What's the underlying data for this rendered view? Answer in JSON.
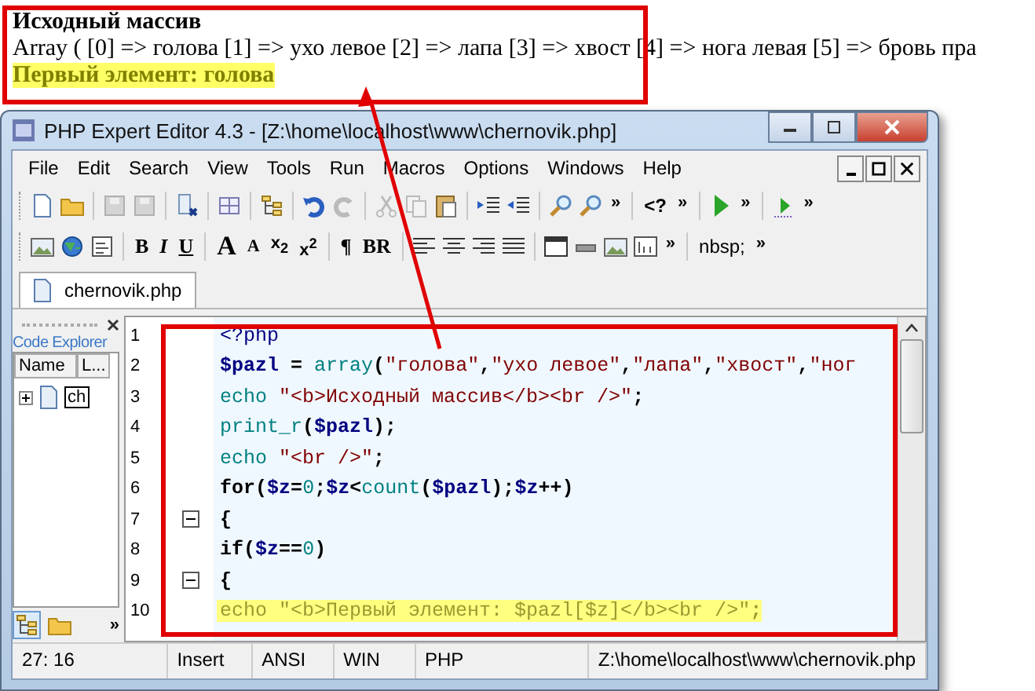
{
  "output": {
    "heading": "Исходный массив",
    "array_line": "Array ( [0] => голова [1] => ухо левое [2] => лапа [3] => хвост [4] => нога левая [5] => бровь пра",
    "first_element": "Первый элемент: голова"
  },
  "window": {
    "title": "PHP Expert Editor 4.3 - [Z:\\home\\localhost\\www\\chernovik.php]"
  },
  "menu": [
    "File",
    "Edit",
    "Search",
    "View",
    "Tools",
    "Run",
    "Macros",
    "Options",
    "Windows",
    "Help"
  ],
  "toolbar_1": [
    "»",
    "<?",
    "»",
    "»",
    "»"
  ],
  "toolbar_2": [
    "B",
    "I",
    "U",
    "A",
    "A",
    "x$_{2}$",
    "x$^{2}$",
    "¶",
    "BR",
    "»",
    "nbsp;",
    "»"
  ],
  "tabs": [
    {
      "label": "chernovik.php",
      "selected": true
    }
  ],
  "code_explorer": {
    "title": "Code Explorer",
    "columns": [
      "Name",
      "L..."
    ],
    "items": [
      {
        "label": "ch",
        "expanded": false
      }
    ],
    "more": "»"
  },
  "editor": {
    "lines": [
      {
        "number": "1",
        "fold": false,
        "highlighted": false,
        "tokens": [
          {
            "kind": "tag",
            "t": "<?php"
          }
        ]
      },
      {
        "number": "2",
        "fold": false,
        "highlighted": false,
        "tokens": [
          {
            "kind": "var",
            "t": "$pazl"
          },
          {
            "kind": "op",
            "t": " = "
          },
          {
            "kind": "fn",
            "t": "array"
          },
          {
            "kind": "op",
            "t": "("
          },
          {
            "kind": "str",
            "t": "\"голова\""
          },
          {
            "kind": "op",
            "t": ","
          },
          {
            "kind": "str",
            "t": "\"ухо левое\""
          },
          {
            "kind": "op",
            "t": ","
          },
          {
            "kind": "str",
            "t": "\"лапа\""
          },
          {
            "kind": "op",
            "t": ","
          },
          {
            "kind": "str",
            "t": "\"хвост\""
          },
          {
            "kind": "op",
            "t": ","
          },
          {
            "kind": "str",
            "t": "\"ног"
          }
        ]
      },
      {
        "number": "3",
        "fold": false,
        "highlighted": false,
        "tokens": [
          {
            "kind": "fn",
            "t": "echo"
          },
          {
            "kind": "str",
            "t": " \"<b>Исходный массив</b><br />\""
          },
          {
            "kind": "op",
            "t": ";"
          }
        ]
      },
      {
        "number": "4",
        "fold": false,
        "highlighted": false,
        "tokens": [
          {
            "kind": "fn",
            "t": "print_r"
          },
          {
            "kind": "op",
            "t": "("
          },
          {
            "kind": "var",
            "t": "$pazl"
          },
          {
            "kind": "op",
            "t": ");"
          }
        ]
      },
      {
        "number": "5",
        "fold": false,
        "highlighted": false,
        "tokens": [
          {
            "kind": "fn",
            "t": "echo"
          },
          {
            "kind": "str",
            "t": " \"<br />\""
          },
          {
            "kind": "op",
            "t": ";"
          }
        ]
      },
      {
        "number": "6",
        "fold": false,
        "highlighted": false,
        "tokens": [
          {
            "kind": "kw",
            "t": "for"
          },
          {
            "kind": "op",
            "t": "("
          },
          {
            "kind": "var",
            "t": "$z"
          },
          {
            "kind": "op",
            "t": "="
          },
          {
            "kind": "num",
            "t": "0"
          },
          {
            "kind": "op",
            "t": ";"
          },
          {
            "kind": "var",
            "t": "$z"
          },
          {
            "kind": "op",
            "t": "<"
          },
          {
            "kind": "fn",
            "t": "count"
          },
          {
            "kind": "op",
            "t": "("
          },
          {
            "kind": "var",
            "t": "$pazl"
          },
          {
            "kind": "op",
            "t": ");"
          },
          {
            "kind": "var",
            "t": "$z"
          },
          {
            "kind": "op",
            "t": "++)"
          }
        ]
      },
      {
        "number": "7",
        "fold": true,
        "highlighted": false,
        "tokens": [
          {
            "kind": "op",
            "t": "{"
          }
        ]
      },
      {
        "number": "8",
        "fold": false,
        "highlighted": false,
        "tokens": [
          {
            "kind": "kw",
            "t": "if"
          },
          {
            "kind": "op",
            "t": "("
          },
          {
            "kind": "var",
            "t": "$z"
          },
          {
            "kind": "op",
            "t": "=="
          },
          {
            "kind": "num",
            "t": "0"
          },
          {
            "kind": "op",
            "t": ")"
          }
        ]
      },
      {
        "number": "9",
        "fold": true,
        "highlighted": false,
        "tokens": [
          {
            "kind": "op",
            "t": "{"
          }
        ]
      },
      {
        "number": "10",
        "fold": false,
        "highlighted": true,
        "tokens": [
          {
            "kind": "fn",
            "t": "echo"
          },
          {
            "kind": "str",
            "t": " \"<b>Первый элемент: $pazl[$z]</b><br />\""
          },
          {
            "kind": "op",
            "t": ";"
          }
        ]
      }
    ]
  },
  "status_bar": [
    "27: 16",
    "Insert",
    "ANSI",
    "WIN",
    "PHP",
    "Z:\\home\\localhost\\www\\chernovik.php"
  ]
}
